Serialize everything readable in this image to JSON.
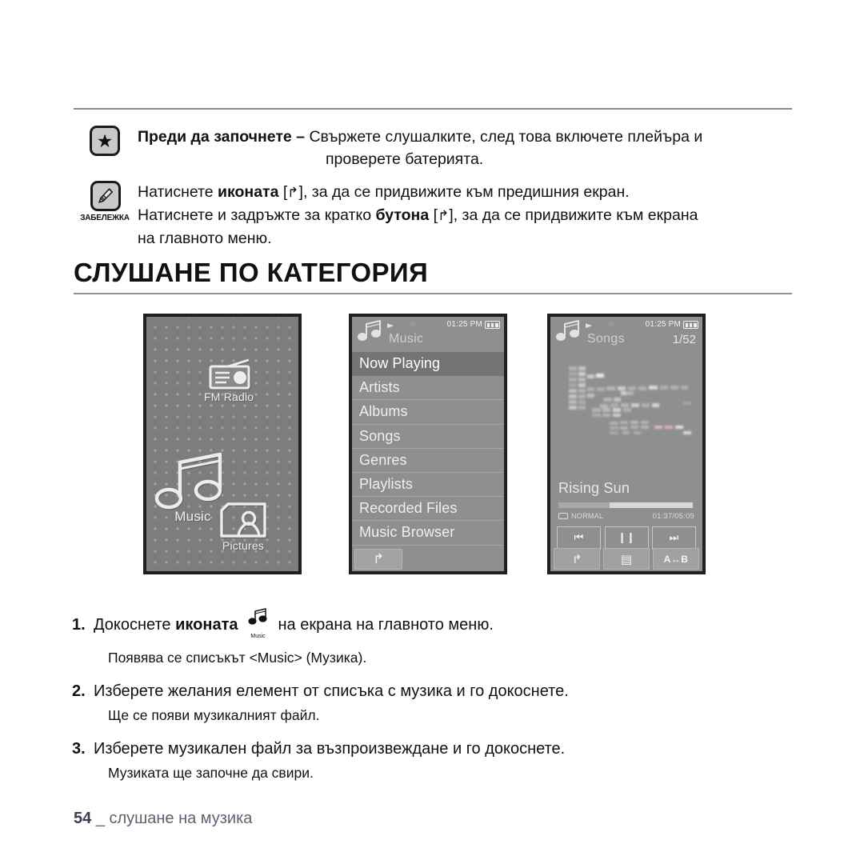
{
  "note": {
    "star_icon": "star-icon",
    "before_label": "Преди да започнете –",
    "before_text": " Свържете слушалките, след това включете плейъра и",
    "before_text_line2": "проверете батерията.",
    "note_caption": "ЗАБЕЛЕЖКА",
    "line1_a": "Натиснете ",
    "line1_b": "иконата",
    "line1_c": " [",
    "line1_glyph": "↰",
    "line1_d": "], за да се придвижите към предишния екран.",
    "line2_a": "Натиснете и задръжте за кратко ",
    "line2_b": "бутона",
    "line2_c": " [",
    "line2_glyph": "↰",
    "line2_d": "], за да се придвижите към екрана",
    "line3": "на главното меню."
  },
  "section": {
    "title": "СЛУШАНЕ ПО КАТЕГОРИЯ"
  },
  "device1": {
    "name": "main-menu-screen",
    "icons": [
      {
        "id": "fm-radio",
        "label": "FM Radio"
      },
      {
        "id": "music",
        "label": "Music"
      },
      {
        "id": "pictures",
        "label": "Pictures"
      }
    ]
  },
  "device2": {
    "name": "music-list-screen",
    "status": {
      "title": "Music",
      "time": "01:25 PM",
      "play_icon": "play-icon",
      "bluetooth_icon": "bluetooth-icon",
      "battery_icon": "battery-icon"
    },
    "items": [
      {
        "label": "Now Playing",
        "selected": true
      },
      {
        "label": "Artists",
        "selected": false
      },
      {
        "label": "Albums",
        "selected": false
      },
      {
        "label": "Songs",
        "selected": false
      },
      {
        "label": "Genres",
        "selected": false
      },
      {
        "label": "Playlists",
        "selected": false
      },
      {
        "label": "Recorded Files",
        "selected": false
      },
      {
        "label": "Music Browser",
        "selected": false
      }
    ],
    "soft_back": "↰"
  },
  "device3": {
    "name": "now-playing-screen",
    "status": {
      "title": "Songs",
      "count": "1/52",
      "time": "01:25 PM",
      "play_icon": "play-icon",
      "bluetooth_icon": "bluetooth-icon",
      "battery_icon": "battery-icon"
    },
    "track_title": "Rising Sun",
    "play_mode": "NORMAL",
    "elapsed": "01:37/05:09",
    "controls": {
      "prev": "⏮",
      "pause": "❙❙",
      "next": "⏭"
    },
    "soft": {
      "back": "↰",
      "list": "▤",
      "ab": "A↔B"
    }
  },
  "steps": [
    {
      "num": "1.",
      "text_a": "Докоснете ",
      "text_b": "иконата",
      "icon_label": "Music",
      "text_c": "на екрана на главното меню.",
      "sub": "Появява се списъкът <Music> (Музика)."
    },
    {
      "num": "2.",
      "text_a": "Изберете желания елемент от списъка с музика и го докоснете.",
      "sub": "Ще се появи музикалният файл."
    },
    {
      "num": "3.",
      "text_a": "Изберете музикален файл за възпроизвеждане и го докоснете.",
      "sub": "Музиката ще започне да свири."
    }
  ],
  "footer": {
    "page": "54",
    "sep": "_",
    "label": "слушане на музика"
  }
}
